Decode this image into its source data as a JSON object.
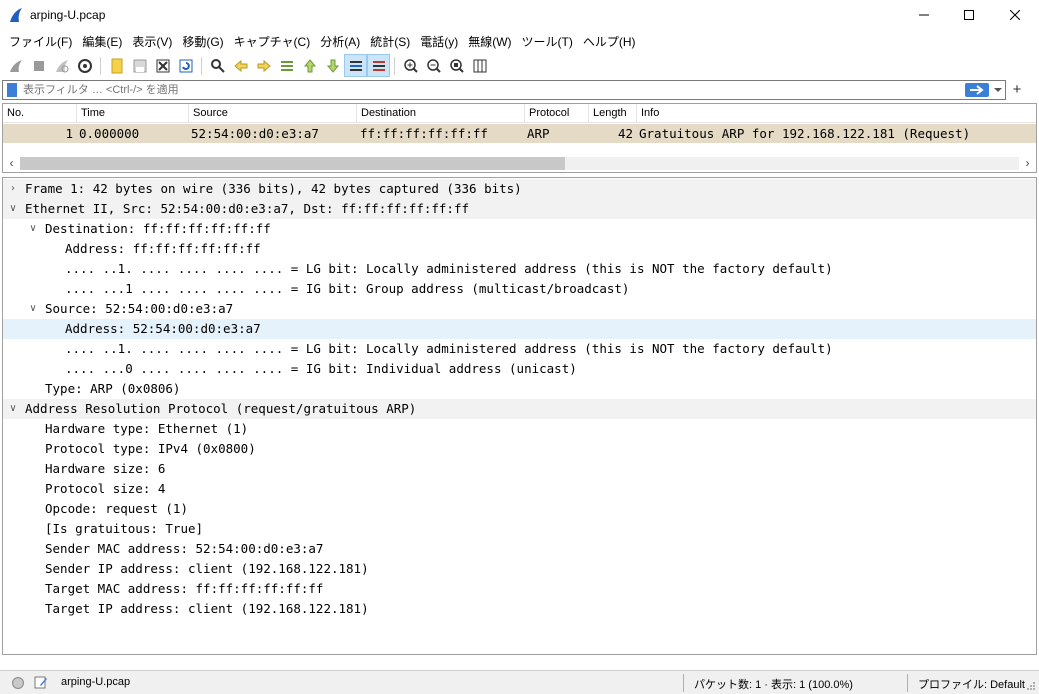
{
  "window": {
    "title": "arping-U.pcap",
    "accent_color": "#3c7fd6"
  },
  "menu": [
    "ファイル(F)",
    "編集(E)",
    "表示(V)",
    "移動(G)",
    "キャプチャ(C)",
    "分析(A)",
    "統計(S)",
    "電話(y)",
    "無線(W)",
    "ツール(T)",
    "ヘルプ(H)"
  ],
  "toolbar": {
    "icons": [
      "shark-start-icon",
      "stop-icon",
      "restart-icon",
      "capture-options-icon",
      "open-file-icon",
      "save-file-icon",
      "close-file-icon",
      "reload-file-icon",
      "find-packet-icon",
      "go-back-icon",
      "go-forward-icon",
      "go-to-packet-icon",
      "go-first-icon",
      "go-last-icon",
      "auto-scroll-icon",
      "colorize-icon",
      "zoom-in-icon",
      "zoom-out-icon",
      "zoom-normal-icon",
      "resize-columns-icon"
    ]
  },
  "filter": {
    "placeholder": "表示フィルタ … <Ctrl-/> を適用"
  },
  "packet_list": {
    "columns": [
      "No.",
      "Time",
      "Source",
      "Destination",
      "Protocol",
      "Length",
      "Info"
    ],
    "rows": [
      {
        "no": "1",
        "time": "0.000000",
        "source": "52:54:00:d0:e3:a7",
        "destination": "ff:ff:ff:ff:ff:ff",
        "protocol": "ARP",
        "length": "42",
        "info": "Gratuitous ARP for 192.168.122.181 (Request)",
        "row_color": "#e4dac5"
      }
    ]
  },
  "details": [
    {
      "text": "Frame 1: 42 bytes on wire (336 bits), 42 bytes captured (336 bits)",
      "toggle": "collapsed"
    },
    {
      "text": "Ethernet II, Src: 52:54:00:d0:e3:a7, Dst: ff:ff:ff:ff:ff:ff",
      "toggle": "expanded"
    },
    {
      "text": "Destination: ff:ff:ff:ff:ff:ff",
      "toggle": "expanded"
    },
    {
      "text": "Address: ff:ff:ff:ff:ff:ff",
      "toggle": "none"
    },
    {
      "text": ".... ..1. .... .... .... .... = LG bit: Locally administered address (this is NOT the factory default)",
      "toggle": "none"
    },
    {
      "text": ".... ...1 .... .... .... .... = IG bit: Group address (multicast/broadcast)",
      "toggle": "none"
    },
    {
      "text": "Source: 52:54:00:d0:e3:a7",
      "toggle": "expanded"
    },
    {
      "text": "Address: 52:54:00:d0:e3:a7",
      "toggle": "none",
      "selected": true
    },
    {
      "text": ".... ..1. .... .... .... .... = LG bit: Locally administered address (this is NOT the factory default)",
      "toggle": "none"
    },
    {
      "text": ".... ...0 .... .... .... .... = IG bit: Individual address (unicast)",
      "toggle": "none"
    },
    {
      "text": "Type: ARP (0x0806)",
      "toggle": "none"
    },
    {
      "text": "Address Resolution Protocol (request/gratuitous ARP)",
      "toggle": "expanded"
    },
    {
      "text": "Hardware type: Ethernet (1)",
      "toggle": "none"
    },
    {
      "text": "Protocol type: IPv4 (0x0800)",
      "toggle": "none"
    },
    {
      "text": "Hardware size: 6",
      "toggle": "none"
    },
    {
      "text": "Protocol size: 4",
      "toggle": "none"
    },
    {
      "text": "Opcode: request (1)",
      "toggle": "none"
    },
    {
      "text": "[Is gratuitous: True]",
      "toggle": "none"
    },
    {
      "text": "Sender MAC address: 52:54:00:d0:e3:a7",
      "toggle": "none"
    },
    {
      "text": "Sender IP address: client (192.168.122.181)",
      "toggle": "none"
    },
    {
      "text": "Target MAC address: ff:ff:ff:ff:ff:ff",
      "toggle": "none"
    },
    {
      "text": "Target IP address: client (192.168.122.181)",
      "toggle": "none"
    }
  ],
  "status": {
    "file": "arping-U.pcap",
    "packets": "パケット数: 1 · 表示: 1 (100.0%)",
    "profile": "プロファイル: Default"
  }
}
